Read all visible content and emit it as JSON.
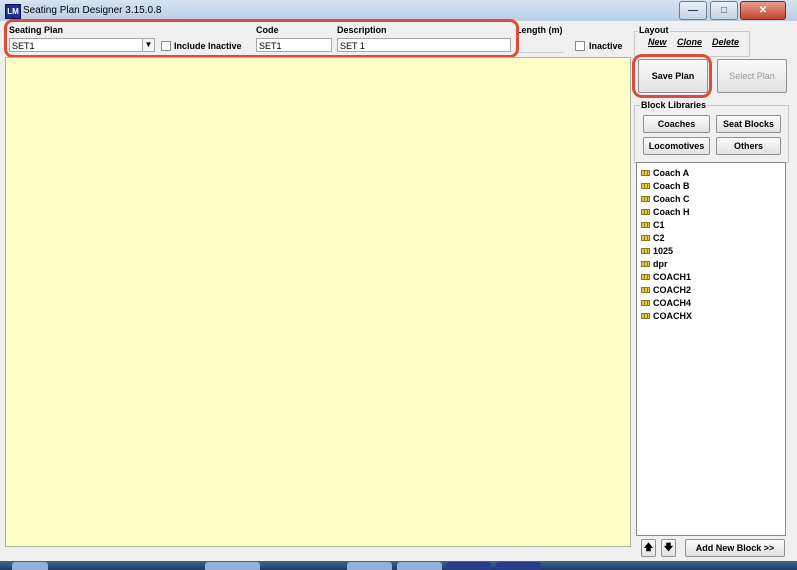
{
  "window": {
    "icon_text": "LM",
    "title": "Seating Plan Designer  3.15.0.8",
    "minimize": "—",
    "maximize": "□",
    "close": "✕"
  },
  "top": {
    "seating_plan_label": "Seating Plan",
    "seating_plan_value": "SET1",
    "include_inactive_label": "Include Inactive",
    "code_label": "Code",
    "code_value": "SET1",
    "description_label": "Description",
    "description_value": "SET 1",
    "length_label": "Length (m)",
    "inactive_label": "Inactive"
  },
  "layout": {
    "group_label": "Layout",
    "new": "New",
    "clone": "Clone",
    "delete": "Delete"
  },
  "actions": {
    "save_plan": "Save Plan",
    "select_plan": "Select Plan"
  },
  "block_libraries": {
    "group_label": "Block Libraries",
    "coaches": "Coaches",
    "seat_blocks": "Seat Blocks",
    "locomotives": "Locomotives",
    "others": "Others",
    "items": [
      "Coach A",
      "Coach B",
      "Coach C",
      "Coach H",
      "C1",
      "C2",
      "1025",
      "dpr",
      "COACH1",
      "COACH2",
      "COACH4",
      "COACHX"
    ]
  },
  "bottom": {
    "up_icon": "arrow-up-icon",
    "down_icon": "arrow-down-icon",
    "add_new_block": "Add New Block >>"
  },
  "colors": {
    "canvas": "#ffffc8",
    "highlight": "#e04a3a"
  }
}
